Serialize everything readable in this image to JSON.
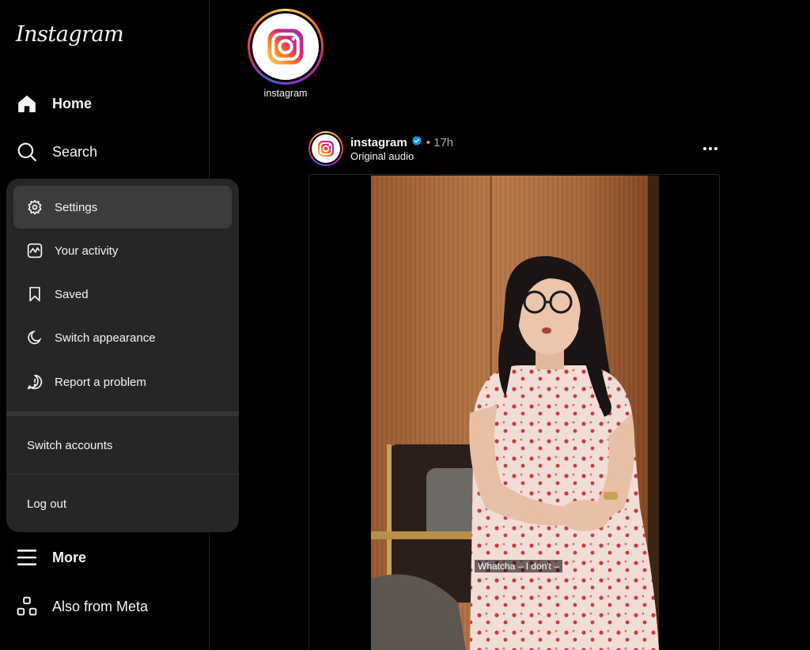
{
  "sidebar": {
    "logo": "Instagram",
    "home": "Home",
    "search": "Search",
    "more": "More",
    "also_from_meta": "Also from Meta"
  },
  "menu": {
    "items": [
      "Settings",
      "Your activity",
      "Saved",
      "Switch appearance",
      "Report a problem"
    ],
    "switch_accounts": "Switch accounts",
    "log_out": "Log out"
  },
  "story": {
    "username": "instagram"
  },
  "post": {
    "username": "instagram",
    "time": "• 17h",
    "audio": "Original audio",
    "subtitle": "Whatcha – I don't –"
  },
  "colors": {
    "background": "#000000",
    "menu_bg": "#262626",
    "menu_active": "#3c3c3c",
    "verified": "#0095f6"
  }
}
